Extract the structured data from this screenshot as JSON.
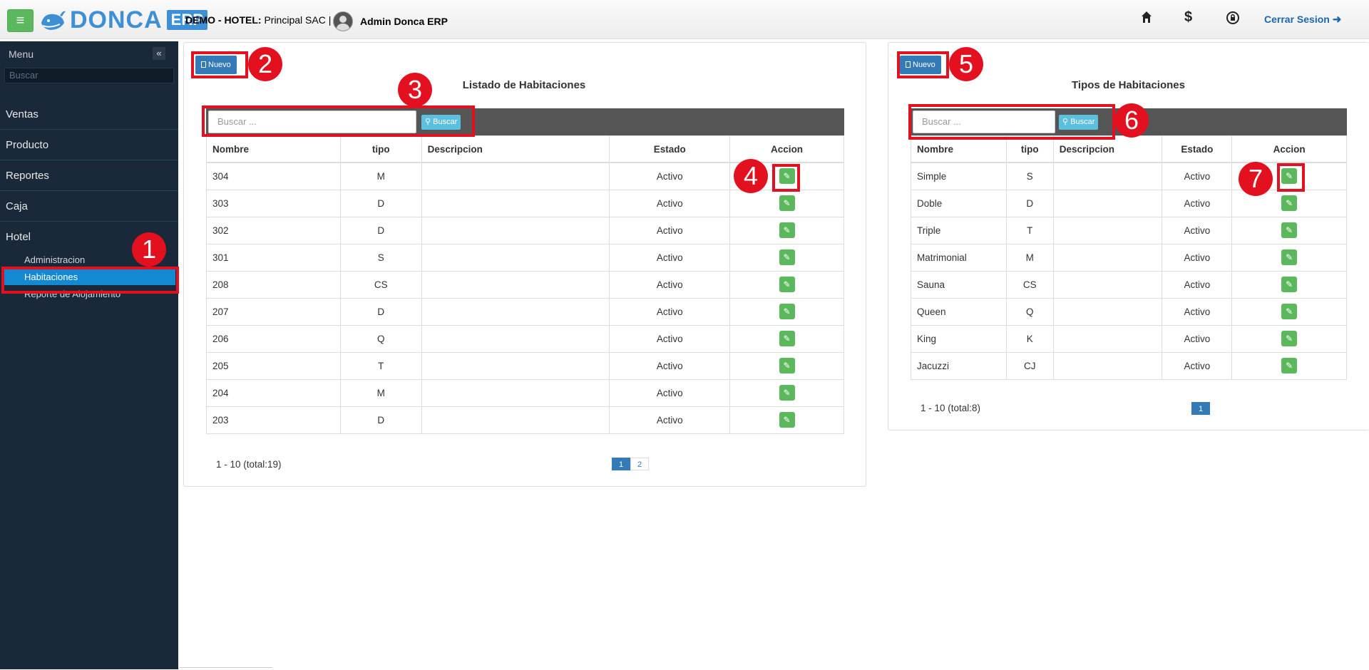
{
  "header": {
    "logo_text": "DONCA",
    "logo_suffix": "ERP",
    "company_label": "DEMO - HOTEL:",
    "company_name": "Principal SAC |",
    "user": "Admin Donca ERP",
    "logout": "Cerrar Sesion"
  },
  "sidebar": {
    "title": "Menu",
    "search_placeholder": "Buscar",
    "items": [
      {
        "label": "Ventas"
      },
      {
        "label": "Producto"
      },
      {
        "label": "Reportes"
      },
      {
        "label": "Caja"
      },
      {
        "label": "Hotel"
      }
    ],
    "hotel_subitems": [
      {
        "label": "Administracion"
      },
      {
        "label": "Habitaciones"
      },
      {
        "label": "Reporte de Alojamiento"
      }
    ]
  },
  "rooms_panel": {
    "new_label": "Nuevo",
    "title": "Listado de Habitaciones",
    "search_placeholder": "Buscar ...",
    "search_button": "Buscar",
    "columns": [
      "Nombre",
      "tipo",
      "Descripcion",
      "Estado",
      "Accion"
    ],
    "rows": [
      [
        "304",
        "M",
        "",
        "Activo"
      ],
      [
        "303",
        "D",
        "",
        "Activo"
      ],
      [
        "302",
        "D",
        "",
        "Activo"
      ],
      [
        "301",
        "S",
        "",
        "Activo"
      ],
      [
        "208",
        "CS",
        "",
        "Activo"
      ],
      [
        "207",
        "D",
        "",
        "Activo"
      ],
      [
        "206",
        "Q",
        "",
        "Activo"
      ],
      [
        "205",
        "T",
        "",
        "Activo"
      ],
      [
        "204",
        "M",
        "",
        "Activo"
      ],
      [
        "203",
        "D",
        "",
        "Activo"
      ]
    ],
    "pager_text": "1 - 10 (total:19)",
    "pages": [
      "1",
      "2"
    ]
  },
  "types_panel": {
    "new_label": "Nuevo",
    "title": "Tipos de Habitaciones",
    "search_placeholder": "Buscar ...",
    "search_button": "Buscar",
    "columns": [
      "Nombre",
      "tipo",
      "Descripcion",
      "Estado",
      "Accion"
    ],
    "rows": [
      [
        "Simple",
        "S",
        "",
        "Activo"
      ],
      [
        "Doble",
        "D",
        "",
        "Activo"
      ],
      [
        "Triple",
        "T",
        "",
        "Activo"
      ],
      [
        "Matrimonial",
        "M",
        "",
        "Activo"
      ],
      [
        "Sauna",
        "CS",
        "",
        "Activo"
      ],
      [
        "Queen",
        "Q",
        "",
        "Activo"
      ],
      [
        "King",
        "K",
        "",
        "Activo"
      ],
      [
        "Jacuzzi",
        "CJ",
        "",
        "Activo"
      ]
    ],
    "pager_text": "1 - 10 (total:8)",
    "pages": [
      "1"
    ]
  },
  "annotations": [
    "1",
    "2",
    "3",
    "4",
    "5",
    "6",
    "7"
  ],
  "colors": {
    "sidebar_bg": "#1a2939",
    "active_item": "#1488d0",
    "primary": "#337ab7",
    "success": "#5cb85c",
    "info": "#5bc0de",
    "highlight": "#e3101f"
  }
}
